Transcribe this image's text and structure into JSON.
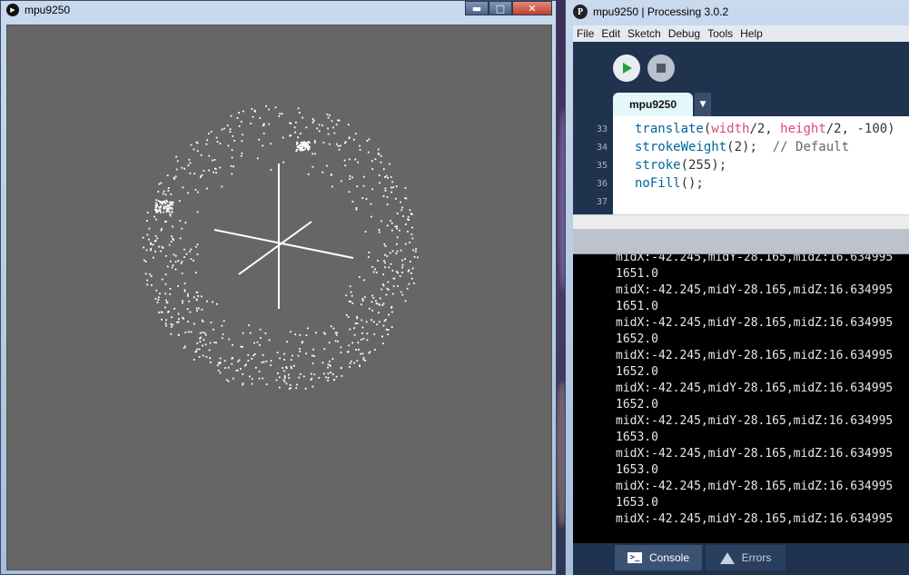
{
  "sketch_window": {
    "title": "mpu9250",
    "controls": {
      "minimize": "▬",
      "maximize": "□",
      "close": "✕"
    },
    "canvas_background": "#666666",
    "point_color": "#ffffff"
  },
  "ide_window": {
    "title": "mpu9250 | Processing 3.0.2",
    "app_icon_glyph": "P",
    "menu": [
      "File",
      "Edit",
      "Sketch",
      "Debug",
      "Tools",
      "Help"
    ],
    "tab_label": "mpu9250",
    "tab_menu_glyph": "▼",
    "code": [
      {
        "line": "33",
        "parts": [
          {
            "t": "translate",
            "c": "kw-fn"
          },
          {
            "t": "(",
            "c": ""
          },
          {
            "t": "width",
            "c": "kw-var"
          },
          {
            "t": "/2, ",
            "c": ""
          },
          {
            "t": "height",
            "c": "kw-var"
          },
          {
            "t": "/2, -100)",
            "c": ""
          }
        ]
      },
      {
        "line": "34",
        "parts": [
          {
            "t": "strokeWeight",
            "c": "kw-fn"
          },
          {
            "t": "(2);  ",
            "c": ""
          },
          {
            "t": "// Default",
            "c": "kw-cmt"
          }
        ]
      },
      {
        "line": "35",
        "parts": [
          {
            "t": "stroke",
            "c": "kw-fn"
          },
          {
            "t": "(255);",
            "c": ""
          }
        ]
      },
      {
        "line": "36",
        "parts": [
          {
            "t": "noFill",
            "c": "kw-fn"
          },
          {
            "t": "();",
            "c": ""
          }
        ]
      },
      {
        "line": "37",
        "parts": []
      }
    ],
    "console_lines": [
      "midX:-42.245,midY-28.165,midZ:16.634995",
      "1651.0",
      "midX:-42.245,midY-28.165,midZ:16.634995",
      "1651.0",
      "midX:-42.245,midY-28.165,midZ:16.634995",
      "1652.0",
      "midX:-42.245,midY-28.165,midZ:16.634995",
      "1652.0",
      "midX:-42.245,midY-28.165,midZ:16.634995",
      "1652.0",
      "midX:-42.245,midY-28.165,midZ:16.634995",
      "1653.0",
      "midX:-42.245,midY-28.165,midZ:16.634995",
      "1653.0",
      "midX:-42.245,midY-28.165,midZ:16.634995",
      "1653.0",
      "midX:-42.245,midY-28.165,midZ:16.634995"
    ],
    "footer_tabs": {
      "console": "Console",
      "errors": "Errors"
    },
    "console_icon_glyph": ">_",
    "colors": {
      "chrome": "#1f334f",
      "tab_active": "#e4f8fb",
      "run_icon": "#22a33a",
      "function": "#006699",
      "variable": "#d94a7a"
    }
  }
}
